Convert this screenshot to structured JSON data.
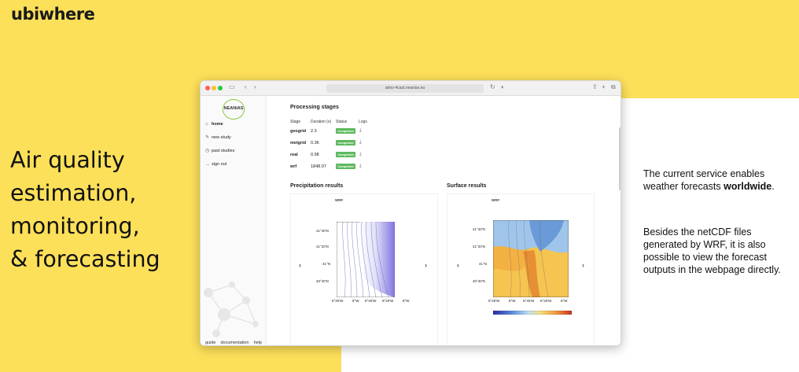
{
  "brand": {
    "logo": "ubiwhere"
  },
  "headline": [
    "Air quality",
    "estimation,",
    "monitoring,",
    "& forecasting"
  ],
  "right_text": {
    "p1_prefix": "The current service enables weather forecasts ",
    "p1_bold": "worldwide",
    "p1_suffix": ".",
    "p2": "Besides the netCDF files generated by WRF, it is also possible to view the forecast outputs in the webpage directly."
  },
  "browser": {
    "url": "atmo-4cast.neanias.eu",
    "app_logo": "NEANIAS",
    "nav": [
      {
        "label": "home",
        "icon": "home-icon",
        "active": true
      },
      {
        "label": "new study",
        "icon": "edit-icon",
        "active": false
      },
      {
        "label": "past studies",
        "icon": "clock-icon",
        "active": false
      },
      {
        "label": "sign out",
        "icon": "signout-icon",
        "active": false
      }
    ],
    "footer": [
      "guide",
      "documentation",
      "help"
    ],
    "processing": {
      "title": "Processing stages",
      "columns": [
        "Stage",
        "Duration (s)",
        "Status",
        "Logs"
      ],
      "rows": [
        {
          "stage": "geogrid",
          "duration": "2.3",
          "status": "Completed"
        },
        {
          "stage": "metgrid",
          "duration": "0.36",
          "status": "Completed"
        },
        {
          "stage": "real",
          "duration": "0.98",
          "status": "Completed"
        },
        {
          "stage": "wrf",
          "duration": "1848.07",
          "status": "Completed"
        }
      ]
    },
    "precipitation": {
      "title": "Precipitation results",
      "model": "WRF",
      "y_ticks": [
        "41°40'N",
        "41°20'N",
        "41°N",
        "40°40'N"
      ],
      "x_ticks": [
        "8°20'W",
        "8°W",
        "8°40'W",
        "8°20'W",
        "8°W"
      ]
    },
    "surface": {
      "title": "Surface results",
      "model": "WRF",
      "y_ticks": [
        "41°40'N",
        "41°20'N",
        "41°N",
        "40°40'N"
      ],
      "x_ticks": [
        "8°20'W",
        "8°W",
        "8°40'W",
        "8°20'W",
        "8°W"
      ]
    }
  },
  "colors": {
    "yellow": "#fde05a",
    "badge_green": "#5cb85c",
    "neanias_green": "#8cc63f"
  }
}
